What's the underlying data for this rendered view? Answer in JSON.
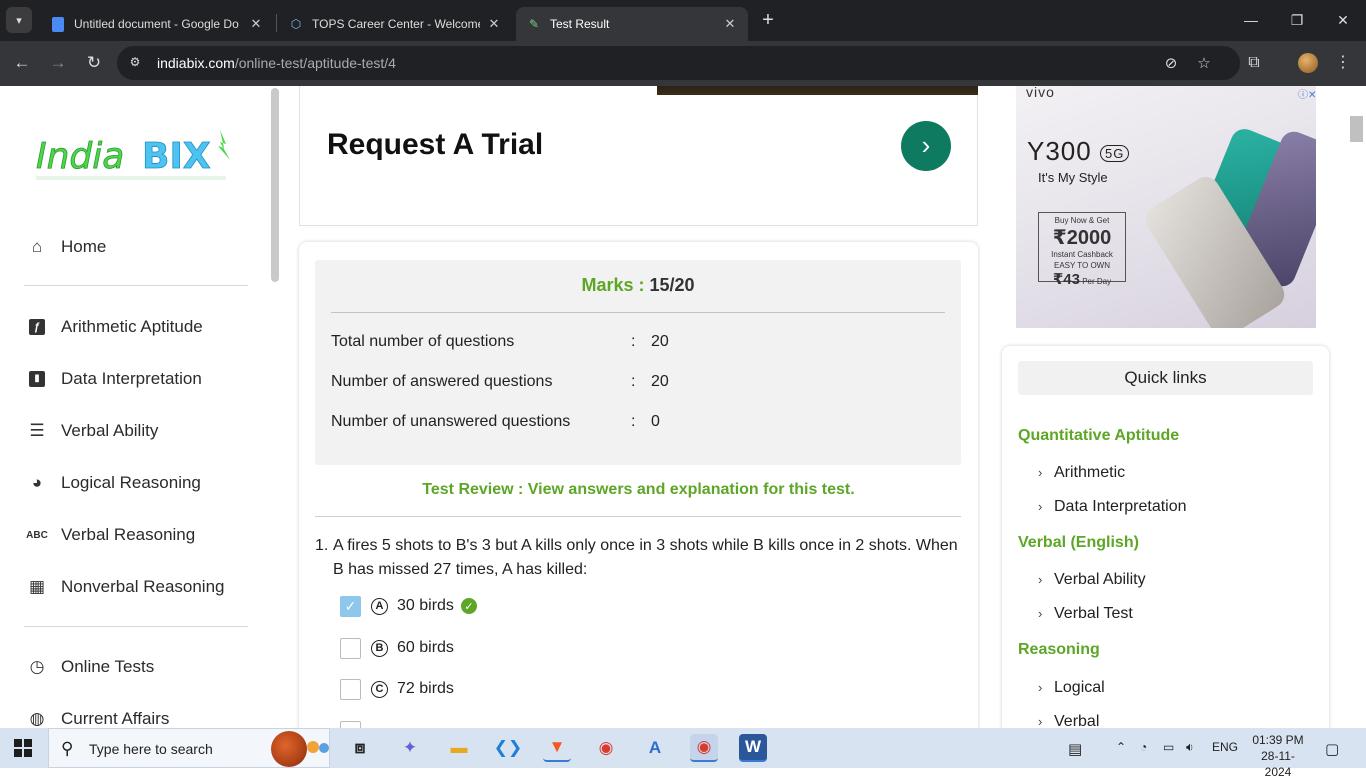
{
  "browser": {
    "tabs": [
      {
        "title": "Untitled document - Google Do",
        "icon": "google-docs-icon"
      },
      {
        "title": "TOPS Career Center - Welcome",
        "icon": "tops-icon"
      },
      {
        "title": "Test Result",
        "icon": "indiabix-icon"
      }
    ],
    "url_host": "indiabix.com",
    "url_path": "/online-test/aptitude-test/4"
  },
  "sidebar": {
    "logo_text": "IndiaBIX",
    "items": [
      {
        "label": "Home",
        "icon": "home-icon"
      },
      {
        "label": "Arithmetic Aptitude",
        "icon": "function-icon"
      },
      {
        "label": "Data Interpretation",
        "icon": "bar-chart-icon"
      },
      {
        "label": "Verbal Ability",
        "icon": "list-check-icon"
      },
      {
        "label": "Logical Reasoning",
        "icon": "brain-icon"
      },
      {
        "label": "Verbal Reasoning",
        "icon": "abc-icon"
      },
      {
        "label": "Nonverbal Reasoning",
        "icon": "dashboard-icon"
      },
      {
        "label": "Online Tests",
        "icon": "clock-icon"
      },
      {
        "label": "Current Affairs",
        "icon": "globe-icon"
      }
    ]
  },
  "trial": {
    "title": "Request A Trial"
  },
  "result": {
    "marks_label": "Marks :",
    "marks_value": "15/20",
    "stats": [
      {
        "label": "Total number of questions",
        "sep": ":",
        "value": "20"
      },
      {
        "label": "Number of answered questions",
        "sep": ":",
        "value": "20"
      },
      {
        "label": "Number of unanswered questions",
        "sep": ":",
        "value": "0"
      }
    ],
    "review_text": "Test Review : View answers and explanation for this test.",
    "question": {
      "number": "1.",
      "text": "A fires 5 shots to B's 3 but A kills only once in 3 shots while B kills once in 2 shots. When B has missed 27 times, A has killed:",
      "options": [
        {
          "letter": "A",
          "text": "30 birds",
          "checked": true,
          "correct": true
        },
        {
          "letter": "B",
          "text": "60 birds",
          "checked": false,
          "correct": false
        },
        {
          "letter": "C",
          "text": "72 birds",
          "checked": false,
          "correct": false
        }
      ]
    }
  },
  "ad": {
    "brand": "vivo",
    "model": "Y300",
    "badge": "5G",
    "tagline": "It's My Style",
    "offer_line1": "Buy Now & Get",
    "offer_amount": "₹2000",
    "offer_line2": "Instant Cashback",
    "emi_label": "EASY TO OWN",
    "emi_amount": "₹43",
    "emi_unit": "Per Day"
  },
  "quick_links": {
    "title": "Quick links",
    "groups": [
      {
        "category": "Quantitative Aptitude",
        "links": [
          "Arithmetic",
          "Data Interpretation"
        ]
      },
      {
        "category": "Verbal (English)",
        "links": [
          "Verbal Ability",
          "Verbal Test"
        ]
      },
      {
        "category": "Reasoning",
        "links": [
          "Logical",
          "Verbal"
        ]
      }
    ]
  },
  "taskbar": {
    "search_placeholder": "Type here to search",
    "language": "ENG",
    "time": "01:39 PM",
    "date": "28-11-2024"
  },
  "colors": {
    "accent_green": "#5da627",
    "trial_button": "#0e7a5f",
    "checkbox_checked": "#8ec6ec"
  }
}
